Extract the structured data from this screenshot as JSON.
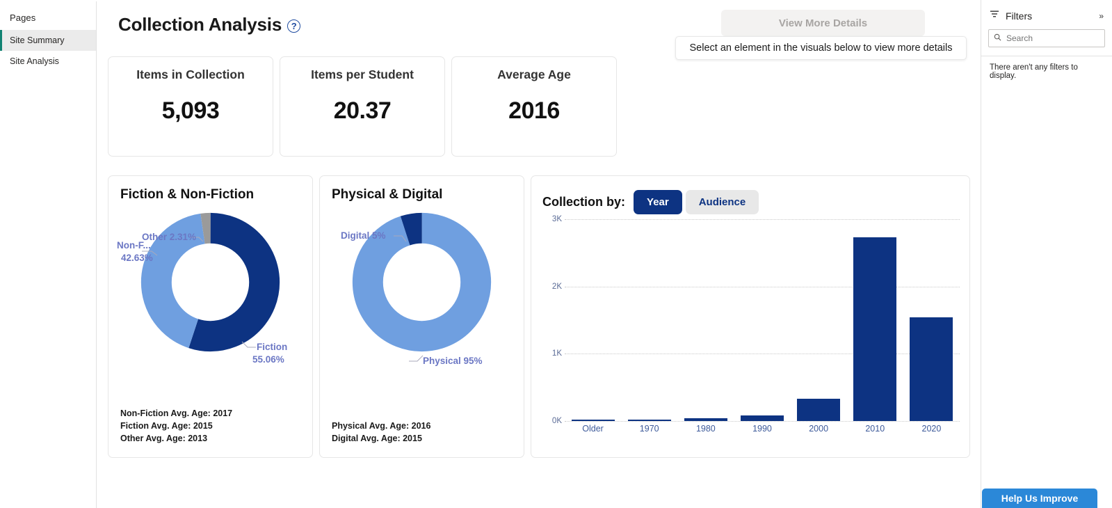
{
  "sidebar": {
    "title": "Pages",
    "items": [
      {
        "label": "Site Summary",
        "selected": true
      },
      {
        "label": "Site Analysis",
        "selected": false
      }
    ]
  },
  "header": {
    "title": "Collection Analysis",
    "help_icon": "question-circle-icon",
    "view_more_button": "View More Details",
    "tooltip": "Select an element in the visuals below to view more details"
  },
  "kpis": [
    {
      "label": "Items in Collection",
      "value": "5,093"
    },
    {
      "label": "Items per Student",
      "value": "20.37"
    },
    {
      "label": "Average Age",
      "value": "2016"
    }
  ],
  "fiction_panel": {
    "title": "Fiction & Non-Fiction",
    "labels": {
      "other": "Other 2.31%",
      "nonfiction_line1": "Non-F...",
      "nonfiction_line2": "42.63%",
      "fiction_line1": "Fiction",
      "fiction_line2": "55.06%"
    },
    "footnotes": [
      "Non-Fiction Avg. Age: 2017",
      "Fiction Avg. Age: 2015",
      "Other Avg. Age: 2013"
    ]
  },
  "physical_panel": {
    "title": "Physical & Digital",
    "labels": {
      "digital": "Digital 5%",
      "physical": "Physical 95%"
    },
    "footnotes": [
      "Physical Avg. Age: 2016",
      "Digital Avg. Age: 2015"
    ]
  },
  "bar_panel": {
    "collection_by_label": "Collection by:",
    "toggle": [
      {
        "label": "Year",
        "selected": true
      },
      {
        "label": "Audience",
        "selected": false
      }
    ]
  },
  "filters": {
    "icon": "filter-icon",
    "title": "Filters",
    "expand_icon": "chevron-right-icon",
    "search_icon": "search-icon",
    "search_placeholder": "Search",
    "search_value": "",
    "empty_message": "There aren't any filters to display."
  },
  "help_improve": {
    "label": "Help Us Improve"
  },
  "colors": {
    "navy": "#0d3382",
    "light_blue": "#6f9fe0",
    "gray": "#9a9a9a",
    "label_purple": "#6b77c4",
    "axis_blue": "#3d5a9a",
    "accent_green": "#118272",
    "help_blue": "#2b88d8"
  },
  "chart_data": [
    {
      "type": "pie",
      "title": "Fiction & Non-Fiction",
      "labels": [
        "Fiction",
        "Non-Fiction",
        "Other"
      ],
      "values": [
        55.06,
        42.63,
        2.31
      ],
      "value_suffix": "%",
      "colors": [
        "#0d3382",
        "#6f9fe0",
        "#9a9a9a"
      ],
      "donut": true,
      "annotations": [
        "Non-Fiction Avg. Age: 2017",
        "Fiction Avg. Age: 2015",
        "Other Avg. Age: 2013"
      ]
    },
    {
      "type": "pie",
      "title": "Physical & Digital",
      "labels": [
        "Physical",
        "Digital"
      ],
      "values": [
        95,
        5
      ],
      "value_suffix": "%",
      "colors": [
        "#6f9fe0",
        "#0d3382"
      ],
      "donut": true,
      "annotations": [
        "Physical Avg. Age: 2016",
        "Digital Avg. Age: 2015"
      ]
    },
    {
      "type": "bar",
      "title": "Collection by Year",
      "categories": [
        "Older",
        "1970",
        "1980",
        "1990",
        "2000",
        "2010",
        "2020"
      ],
      "values": [
        8,
        8,
        45,
        85,
        330,
        2730,
        1540
      ],
      "xlabel": "",
      "ylabel": "",
      "ylim": [
        0,
        3000
      ],
      "ytick_labels": [
        "0K",
        "1K",
        "2K",
        "3K"
      ],
      "ytick_values": [
        0,
        1000,
        2000,
        3000
      ],
      "grid": true,
      "legend": "none",
      "bar_color": "#0d3382"
    }
  ]
}
